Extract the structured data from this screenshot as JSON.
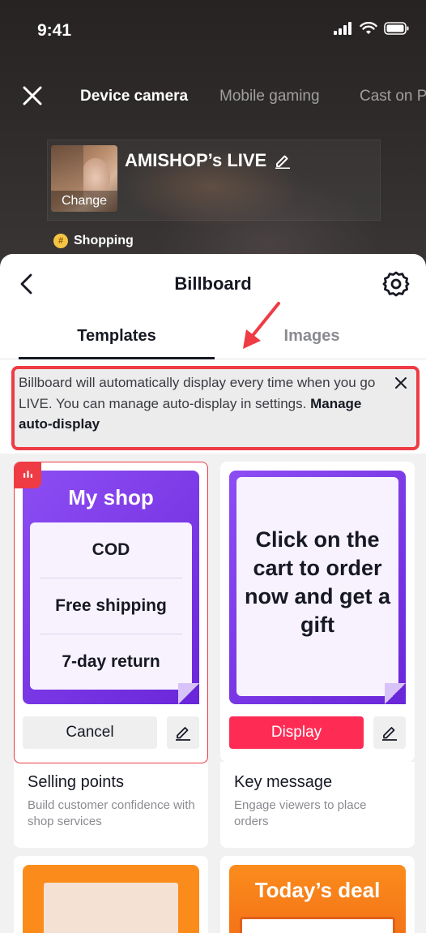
{
  "status_bar": {
    "time": "9:41"
  },
  "top_nav": {
    "tabs": [
      {
        "label": "Device camera"
      },
      {
        "label": "Mobile gaming"
      },
      {
        "label": "Cast on P"
      }
    ]
  },
  "live": {
    "change_label": "Change",
    "title": "AMISHOP’s LIVE",
    "category_icon": "#",
    "category": "Shopping"
  },
  "sheet": {
    "title": "Billboard",
    "tabs": [
      {
        "label": "Templates"
      },
      {
        "label": "Images"
      }
    ],
    "notice": {
      "text": "Billboard will automatically display every time when you go LIVE. You can manage auto-display in settings. ",
      "link": "Manage auto-display"
    }
  },
  "cards": [
    {
      "template_title": "My shop",
      "items": [
        "COD",
        "Free shipping",
        "7-day return"
      ],
      "button": "Cancel",
      "title": "Selling points",
      "desc": "Build customer confidence with shop services"
    },
    {
      "template_text": "Click on the cart to order now and get a gift",
      "button": "Display",
      "title": "Key message",
      "desc": "Engage viewers to place orders"
    },
    {
      "template_title": ""
    },
    {
      "template_title": "Today’s deal"
    }
  ],
  "colors": {
    "accent_red": "#fe2c55",
    "highlight_red": "#ee3b44",
    "purple": "#7a36e6",
    "orange": "#fb8c1c"
  }
}
